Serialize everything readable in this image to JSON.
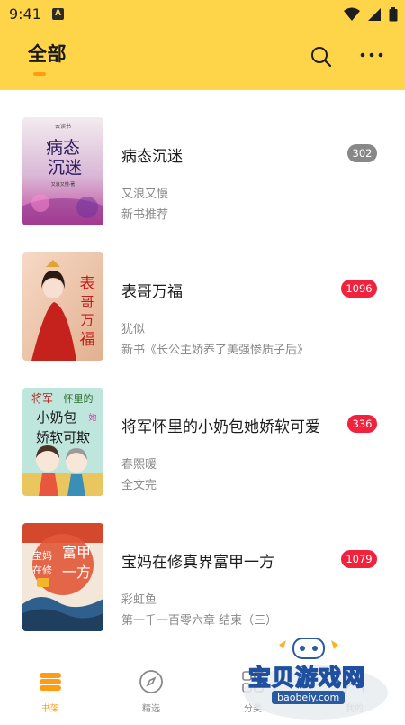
{
  "status_bar": {
    "time": "9:41",
    "notification_letter": "A",
    "icons": [
      "wifi-icon",
      "signal-icon",
      "battery-icon"
    ]
  },
  "header": {
    "title": "全部",
    "icons": [
      "search-icon",
      "more-icon"
    ]
  },
  "books": [
    {
      "title": "病态沉迷",
      "author": "又浪又慢",
      "latest": "新书推荐",
      "badge": "302",
      "badge_color": "#888888",
      "cover_text": "病态沉迷"
    },
    {
      "title": "表哥万福",
      "author": "犹似",
      "latest": "新书《长公主娇养了美强惨质子后》",
      "badge": "1096",
      "badge_color": "#f0223e",
      "cover_text": "表哥万福"
    },
    {
      "title": "将军怀里的小奶包她娇软可爱",
      "author": "春熙暖",
      "latest": "全文完",
      "badge": "336",
      "badge_color": "#f0223e",
      "cover_text": "将军怀里的小奶包她娇软可欺"
    },
    {
      "title": "宝妈在修真界富甲一方",
      "author": "彩虹鱼",
      "latest": "第一千一百零六章 结束（三）",
      "badge": "1079",
      "badge_color": "#f0223e",
      "cover_text": "宝妈在修真界富甲一方"
    }
  ],
  "bottom_nav": {
    "items": [
      {
        "label": "书架",
        "icon": "bookshelf-icon",
        "active": true
      },
      {
        "label": "精选",
        "icon": "compass-icon",
        "active": false
      },
      {
        "label": "分类",
        "icon": "category-icon",
        "active": false
      },
      {
        "label": "我的",
        "icon": "profile-icon",
        "active": false
      }
    ]
  },
  "watermark": {
    "name": "宝贝游戏网",
    "url": "baobeiy.com"
  },
  "colors": {
    "brand_yellow": "#fed448",
    "accent_orange": "#ff9c12",
    "badge_red": "#f0223e",
    "badge_gray": "#888888"
  }
}
